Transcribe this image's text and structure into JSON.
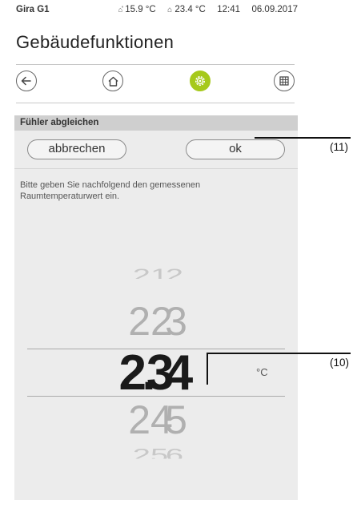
{
  "statusbar": {
    "brand": "Gira G1",
    "temp1": "15.9 °C",
    "temp2": "23.4 °C",
    "time": "12:41",
    "date": "06.09.2017"
  },
  "page": {
    "title": "Gebäudefunktionen"
  },
  "nav": {
    "back_icon": "arrow-left-icon",
    "home_icon": "home-icon",
    "settings_icon": "gear-icon",
    "grid_icon": "grid-icon",
    "accent": "#a6c91b"
  },
  "dialog": {
    "header": "Fühler abgleichen",
    "cancel_label": "abbrechen",
    "ok_label": "ok",
    "description": "Bitte geben Sie nachfolgend den gemessenen Raumtemperaturwert ein."
  },
  "picker": {
    "int_values": [
      "21",
      "22",
      "23",
      "24",
      "25"
    ],
    "dec_values": [
      "2",
      "3",
      "4",
      "5",
      "6"
    ],
    "decimal_point": ".",
    "selected": "23.4",
    "unit": "°C"
  },
  "callouts": {
    "ok": "(11)",
    "value": "(10)"
  }
}
